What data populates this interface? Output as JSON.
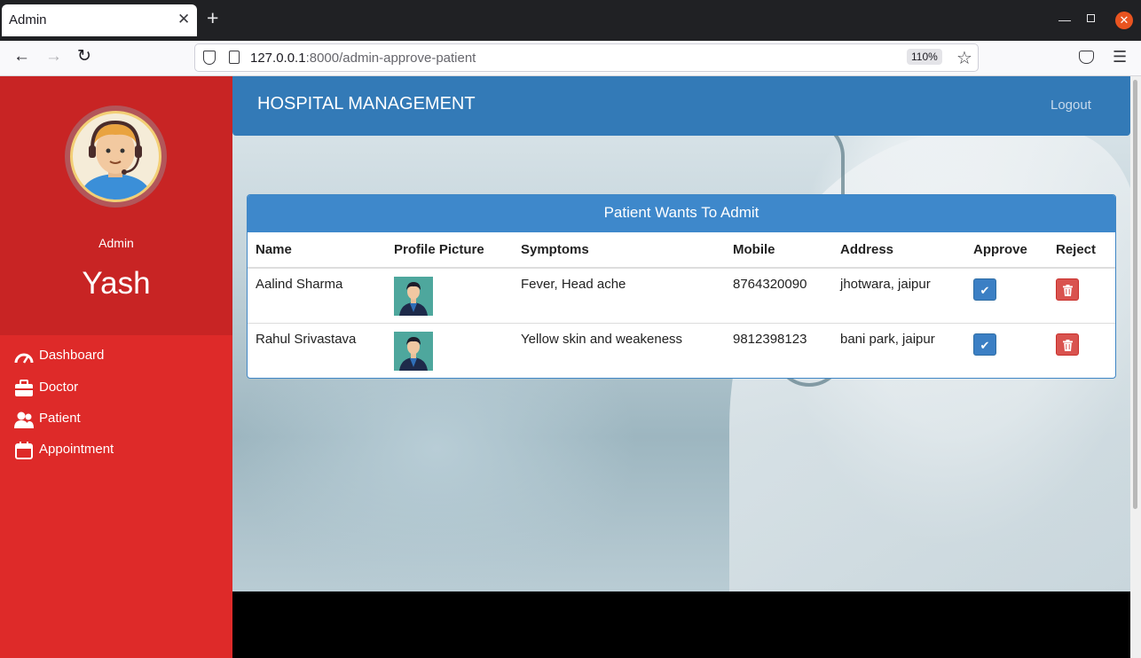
{
  "browser": {
    "tab_title": "Admin",
    "url_host": "127.0.0.1",
    "url_rest": ":8000/admin-approve-patient",
    "zoom": "110%"
  },
  "header": {
    "brand": "HOSPITAL MANAGEMENT",
    "logout": "Logout"
  },
  "sidebar": {
    "role": "Admin",
    "user_name": "Yash",
    "items": [
      {
        "label": "Dashboard",
        "icon": "dashboard-gauge-icon"
      },
      {
        "label": "Doctor",
        "icon": "briefcase-icon"
      },
      {
        "label": "Patient",
        "icon": "users-icon"
      },
      {
        "label": "Appointment",
        "icon": "calendar-icon"
      }
    ]
  },
  "panel": {
    "title": "Patient Wants To Admit",
    "columns": [
      "Name",
      "Profile Picture",
      "Symptoms",
      "Mobile",
      "Address",
      "Approve",
      "Reject"
    ],
    "rows": [
      {
        "name": "Aalind Sharma",
        "symptoms": "Fever, Head ache",
        "mobile": "8764320090",
        "address": "jhotwara, jaipur"
      },
      {
        "name": "Rahul Srivastava",
        "symptoms": "Yellow skin and weakeness",
        "mobile": "9812398123",
        "address": "bani park, jaipur"
      }
    ]
  },
  "colors": {
    "sidebar": "#de2a29",
    "sidebar_top": "#c82424",
    "header": "#337ab7",
    "panel_heading": "#3e88cb",
    "approve_button": "#3b7fc4",
    "reject_button": "#d9534f"
  }
}
